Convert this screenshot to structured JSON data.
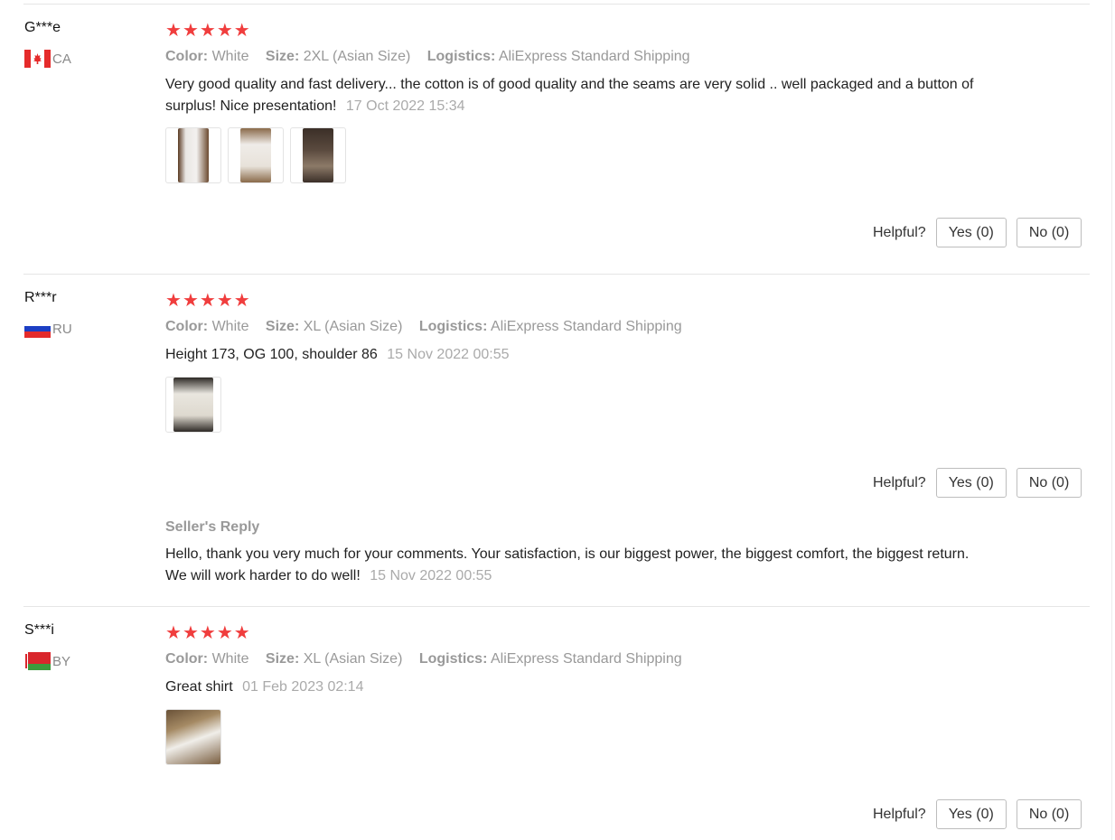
{
  "attr_labels": {
    "color": "Color:",
    "size": "Size:",
    "logistics": "Logistics:"
  },
  "reviews": [
    {
      "user": "G***e",
      "country": "CA",
      "flag": "canada-flag",
      "rating": 5,
      "color": "White",
      "size": "2XL (Asian Size)",
      "logistics": "AliExpress Standard Shipping",
      "text": "Very good quality and fast delivery... the cotton is of good quality and the seams are very solid .. well packaged and a button of surplus! Nice presentation!",
      "date": "17 Oct 2022 15:34",
      "helpful_label": "Helpful?",
      "yes_label": "Yes (0)",
      "no_label": "No (0)"
    },
    {
      "user": "R***r",
      "country": "RU",
      "flag": "russia-flag",
      "rating": 5,
      "color": "White",
      "size": "XL (Asian Size)",
      "logistics": "AliExpress Standard Shipping",
      "text": "Height 173, OG 100, shoulder 86",
      "date": "15 Nov 2022 00:55",
      "helpful_label": "Helpful?",
      "yes_label": "Yes (0)",
      "no_label": "No (0)",
      "seller_reply": {
        "title": "Seller's Reply",
        "text": "Hello, thank you very much for your comments. Your satisfaction, is our biggest power, the biggest comfort, the biggest return. We will work harder to do well!",
        "date": "15 Nov 2022 00:55"
      }
    },
    {
      "user": "S***i",
      "country": "BY",
      "flag": "belarus-flag",
      "rating": 5,
      "color": "White",
      "size": "XL (Asian Size)",
      "logistics": "AliExpress Standard Shipping",
      "text": "Great shirt",
      "date": "01 Feb 2023 02:14",
      "helpful_label": "Helpful?",
      "yes_label": "Yes (0)",
      "no_label": "No (0)"
    }
  ],
  "colors": {
    "star": "#f03d3d",
    "muted": "#999999",
    "divider": "#e6e6e6"
  }
}
